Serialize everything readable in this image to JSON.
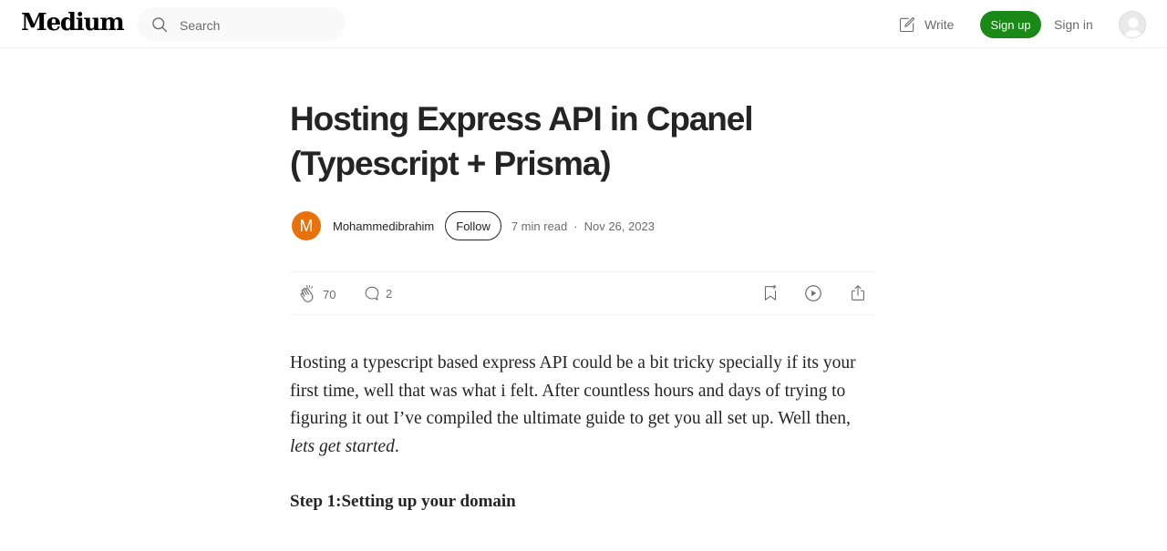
{
  "header": {
    "logo": "Medium",
    "search_placeholder": "Search",
    "write_label": "Write",
    "signup_label": "Sign up",
    "signin_label": "Sign in"
  },
  "article": {
    "title": "Hosting Express API in Cpanel (Typescript + Prisma)",
    "author": {
      "initial": "M",
      "name": "Mohammedibrahim",
      "avatar_color": "#e8710a"
    },
    "follow_label": "Follow",
    "read_time": "7 min read",
    "separator": "·",
    "date": "Nov 26, 2023",
    "claps": "70",
    "comments": "2",
    "paragraph_main": "Hosting a typescript based express API could be a bit tricky specially if its your first time, well that was what i felt. After countless hours and days of trying to figuring it out I’ve compiled the ultimate guide to get you all set up. Well then, ",
    "paragraph_italic": "lets get started",
    "paragraph_end": ".",
    "step_heading": "Step 1:Setting up your domain"
  },
  "colors": {
    "accent_green": "#1a8917",
    "text": "#242424",
    "muted": "#6b6b6b"
  },
  "icons": [
    "search-icon",
    "write-icon",
    "clap-icon",
    "comment-icon",
    "bookmark-icon",
    "listen-icon",
    "share-icon",
    "user-avatar-icon"
  ]
}
